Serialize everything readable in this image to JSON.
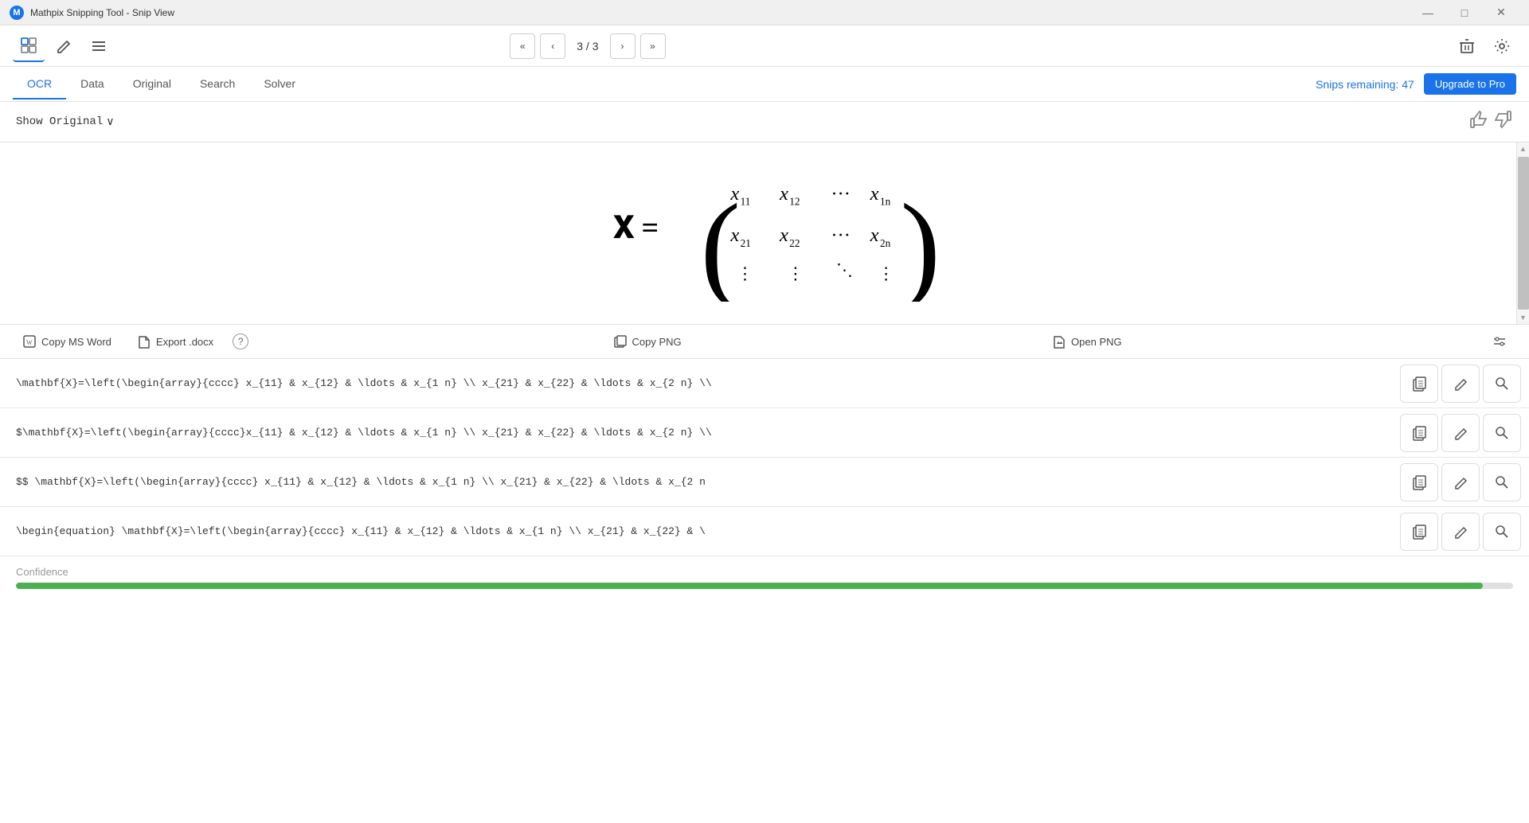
{
  "titlebar": {
    "logo": "M",
    "title": "Mathpix Snipping Tool - Snip View",
    "minimize": "—",
    "maximize": "□",
    "close": "✕"
  },
  "toolbar": {
    "snip_icon": "⊞",
    "edit_icon": "✎",
    "menu_icon": "≡",
    "nav_first": "«",
    "nav_prev": "‹",
    "nav_label": "3 / 3",
    "nav_next": "›",
    "nav_last": "»",
    "delete_icon": "🗑",
    "settings_icon": "⚙"
  },
  "tabs": {
    "items": [
      {
        "id": "ocr",
        "label": "OCR",
        "active": true
      },
      {
        "id": "data",
        "label": "Data",
        "active": false
      },
      {
        "id": "original",
        "label": "Original",
        "active": false
      },
      {
        "id": "search",
        "label": "Search",
        "active": false
      },
      {
        "id": "solver",
        "label": "Solver",
        "active": false
      }
    ],
    "snips_remaining": "Snips remaining: 47",
    "upgrade_label": "Upgrade to Pro"
  },
  "show_original": {
    "label": "Show Original",
    "chevron": "∨"
  },
  "export_bar": {
    "copy_word_label": "Copy MS Word",
    "export_docx_label": "Export .docx",
    "help_label": "?",
    "copy_png_label": "Copy PNG",
    "open_png_label": "Open PNG",
    "settings_icon": "⚙"
  },
  "latex_rows": [
    {
      "text": "\\mathbf{X}=\\left(\\begin{array}{cccc} x_{11} & x_{12} & \\ldots & x_{1 n} \\\\ x_{21} & x_{22} & \\ldots & x_{2 n} \\\\"
    },
    {
      "text": "$\\mathbf{X}=\\left(\\begin{array}{cccc}x_{11} & x_{12} & \\ldots & x_{1 n} \\\\ x_{21} & x_{22} & \\ldots & x_{2 n} \\\\"
    },
    {
      "text": "$$  \\mathbf{X}=\\left(\\begin{array}{cccc} x_{11} & x_{12} & \\ldots & x_{1 n} \\\\ x_{21} & x_{22} & \\ldots & x_{2 n"
    },
    {
      "text": "\\begin{equation}   \\mathbf{X}=\\left(\\begin{array}{cccc} x_{11} & x_{12} & \\ldots & x_{1 n} \\\\ x_{21} & x_{22} & \\"
    }
  ],
  "confidence": {
    "label": "Confidence",
    "value": 98,
    "color": "#4caf50"
  },
  "copy_button": {
    "label": "Copy"
  }
}
